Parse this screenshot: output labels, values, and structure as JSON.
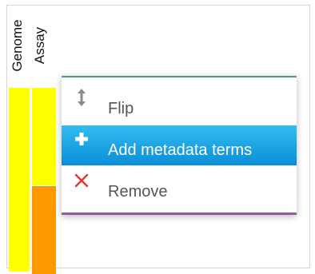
{
  "columns": [
    {
      "label": "Genome"
    },
    {
      "label": "Assay"
    }
  ],
  "context_menu": {
    "items": [
      {
        "label": "Flip",
        "icon": "updown-arrow-icon",
        "state": "normal"
      },
      {
        "label": "Add metadata terms",
        "icon": "plus-icon",
        "state": "highlighted"
      },
      {
        "label": "Remove",
        "icon": "close-x-icon",
        "state": "normal"
      }
    ]
  },
  "colors": {
    "track_yellow": "#ffff00",
    "track_orange": "#ff9900",
    "menu_highlight": "#1a9fe3",
    "menu_top_border": "#4e9a8a",
    "menu_bottom_border": "#9d55a8",
    "remove_icon": "#e8322b"
  }
}
